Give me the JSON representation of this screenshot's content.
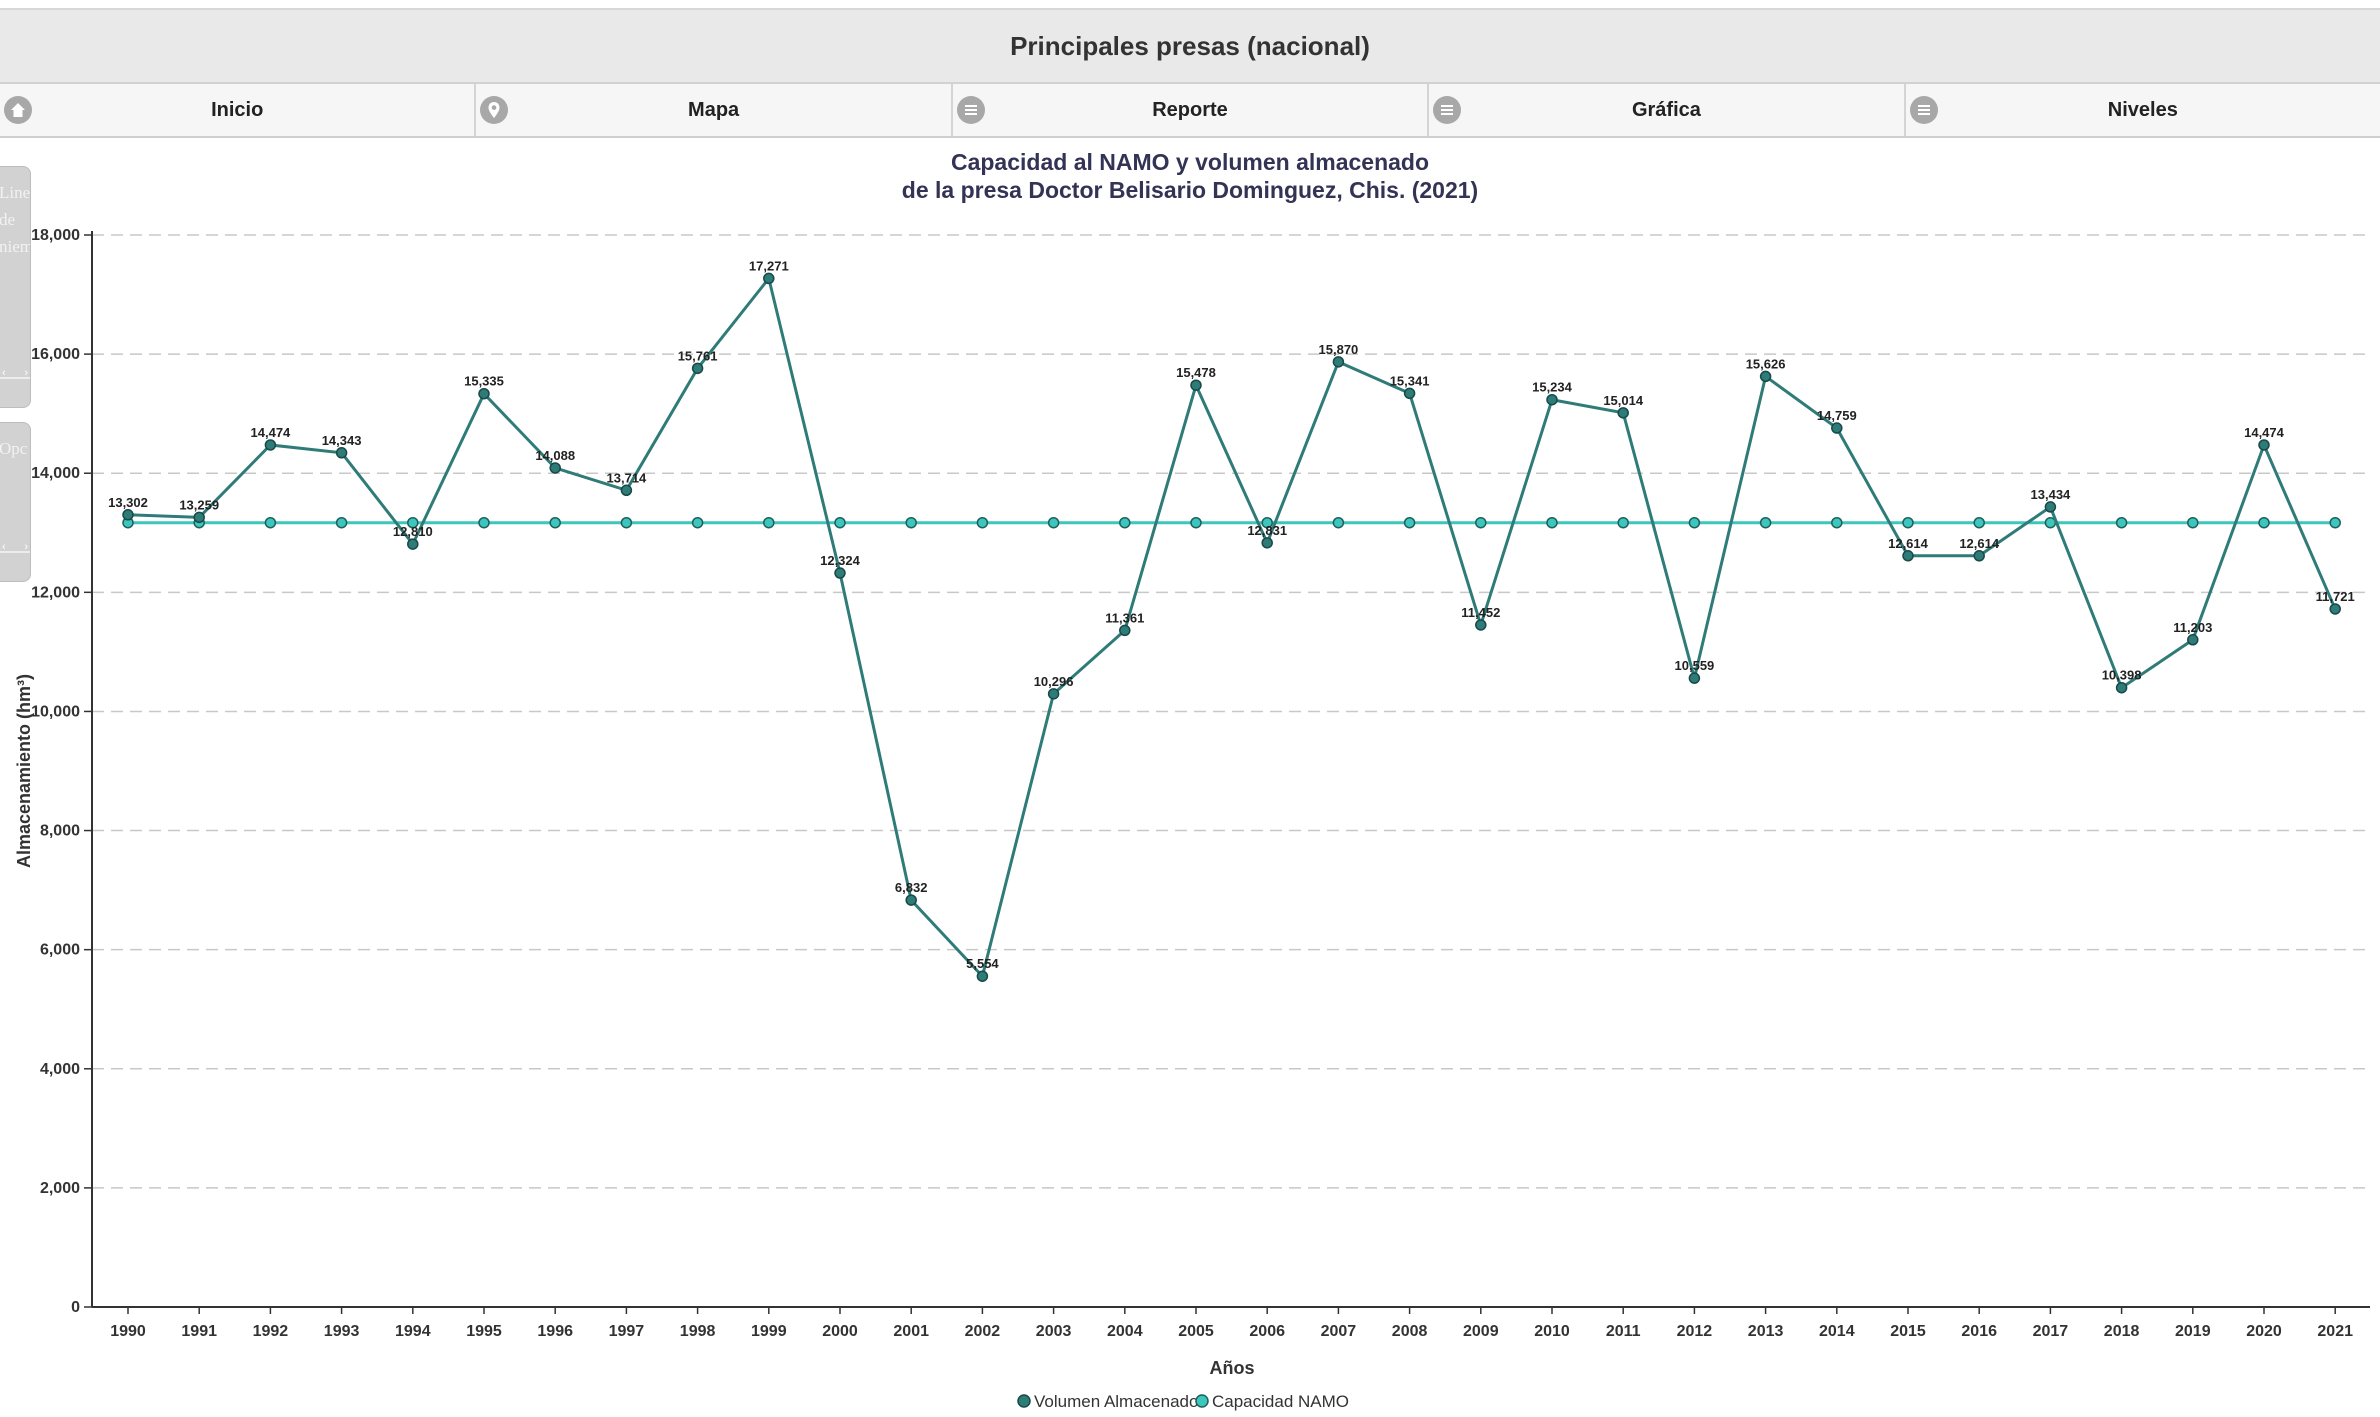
{
  "header": {
    "title": "Principales presas (nacional)"
  },
  "nav": {
    "items": [
      {
        "label": "Inicio",
        "icon": "home-icon"
      },
      {
        "label": "Mapa",
        "icon": "map-pin-icon"
      },
      {
        "label": "Reporte",
        "icon": "menu-icon"
      },
      {
        "label": "Gráfica",
        "icon": "menu-icon"
      },
      {
        "label": "Niveles",
        "icon": "menu-icon"
      }
    ]
  },
  "side_panels": [
    {
      "text": "Line\nde\nniem"
    },
    {
      "text": "Opc"
    }
  ],
  "colors": {
    "volume": "#2e7b78",
    "namo": "#3cc6bc",
    "grid": "#c8c8c8",
    "axis": "#333333"
  },
  "chart_data": {
    "type": "line",
    "title": "Capacidad al NAMO y volumen almacenado",
    "subtitle": "de la presa Doctor Belisario Dominguez, Chis. (2021)",
    "xlabel": "Años",
    "ylabel": "Almacenamiento (hm³)",
    "ylim": [
      0,
      18000
    ],
    "yticks": [
      "0",
      "2,000",
      "4,000",
      "6,000",
      "8,000",
      "10,000",
      "12,000",
      "14,000",
      "16,000",
      "18,000"
    ],
    "grid": true,
    "legend": "bottom-center",
    "categories": [
      "1990",
      "1991",
      "1992",
      "1993",
      "1994",
      "1995",
      "1996",
      "1997",
      "1998",
      "1999",
      "2000",
      "2001",
      "2002",
      "2003",
      "2004",
      "2005",
      "2006",
      "2007",
      "2008",
      "2009",
      "2010",
      "2011",
      "2012",
      "2013",
      "2014",
      "2015",
      "2016",
      "2017",
      "2018",
      "2019",
      "2020",
      "2021"
    ],
    "series": [
      {
        "name": "Volumen Almacenado",
        "values": [
          13302,
          13259,
          14474,
          14343,
          12810,
          15335,
          14088,
          13714,
          15761,
          17271,
          12324,
          6832,
          5554,
          10296,
          11361,
          15478,
          12831,
          15870,
          15341,
          11452,
          15234,
          15014,
          10559,
          15626,
          14759,
          12614,
          12614,
          13434,
          10398,
          11203,
          14474,
          11721
        ],
        "labels": [
          "13,302",
          "13,259",
          "14,474",
          "14,343",
          "12,810",
          "15,335",
          "14,088",
          "13,714",
          "15,761",
          "17,271",
          "12,324",
          "6,832",
          "5,554",
          "10,296",
          "11,361",
          "15,478",
          "12,831",
          "15,870",
          "15,341",
          "11,452",
          "15,234",
          "15,014",
          "10,559",
          "15,626",
          "14,759",
          "12,614",
          "12,614",
          "13,434",
          "10,398",
          "11,203",
          "14,474",
          "11,721"
        ]
      },
      {
        "name": "Capacidad NAMO",
        "values": [
          13169,
          13169,
          13169,
          13169,
          13169,
          13169,
          13169,
          13169,
          13169,
          13169,
          13169,
          13169,
          13169,
          13169,
          13169,
          13169,
          13169,
          13169,
          13169,
          13169,
          13169,
          13169,
          13169,
          13169,
          13169,
          13169,
          13169,
          13169,
          13169,
          13169,
          13169,
          13169
        ]
      }
    ]
  }
}
